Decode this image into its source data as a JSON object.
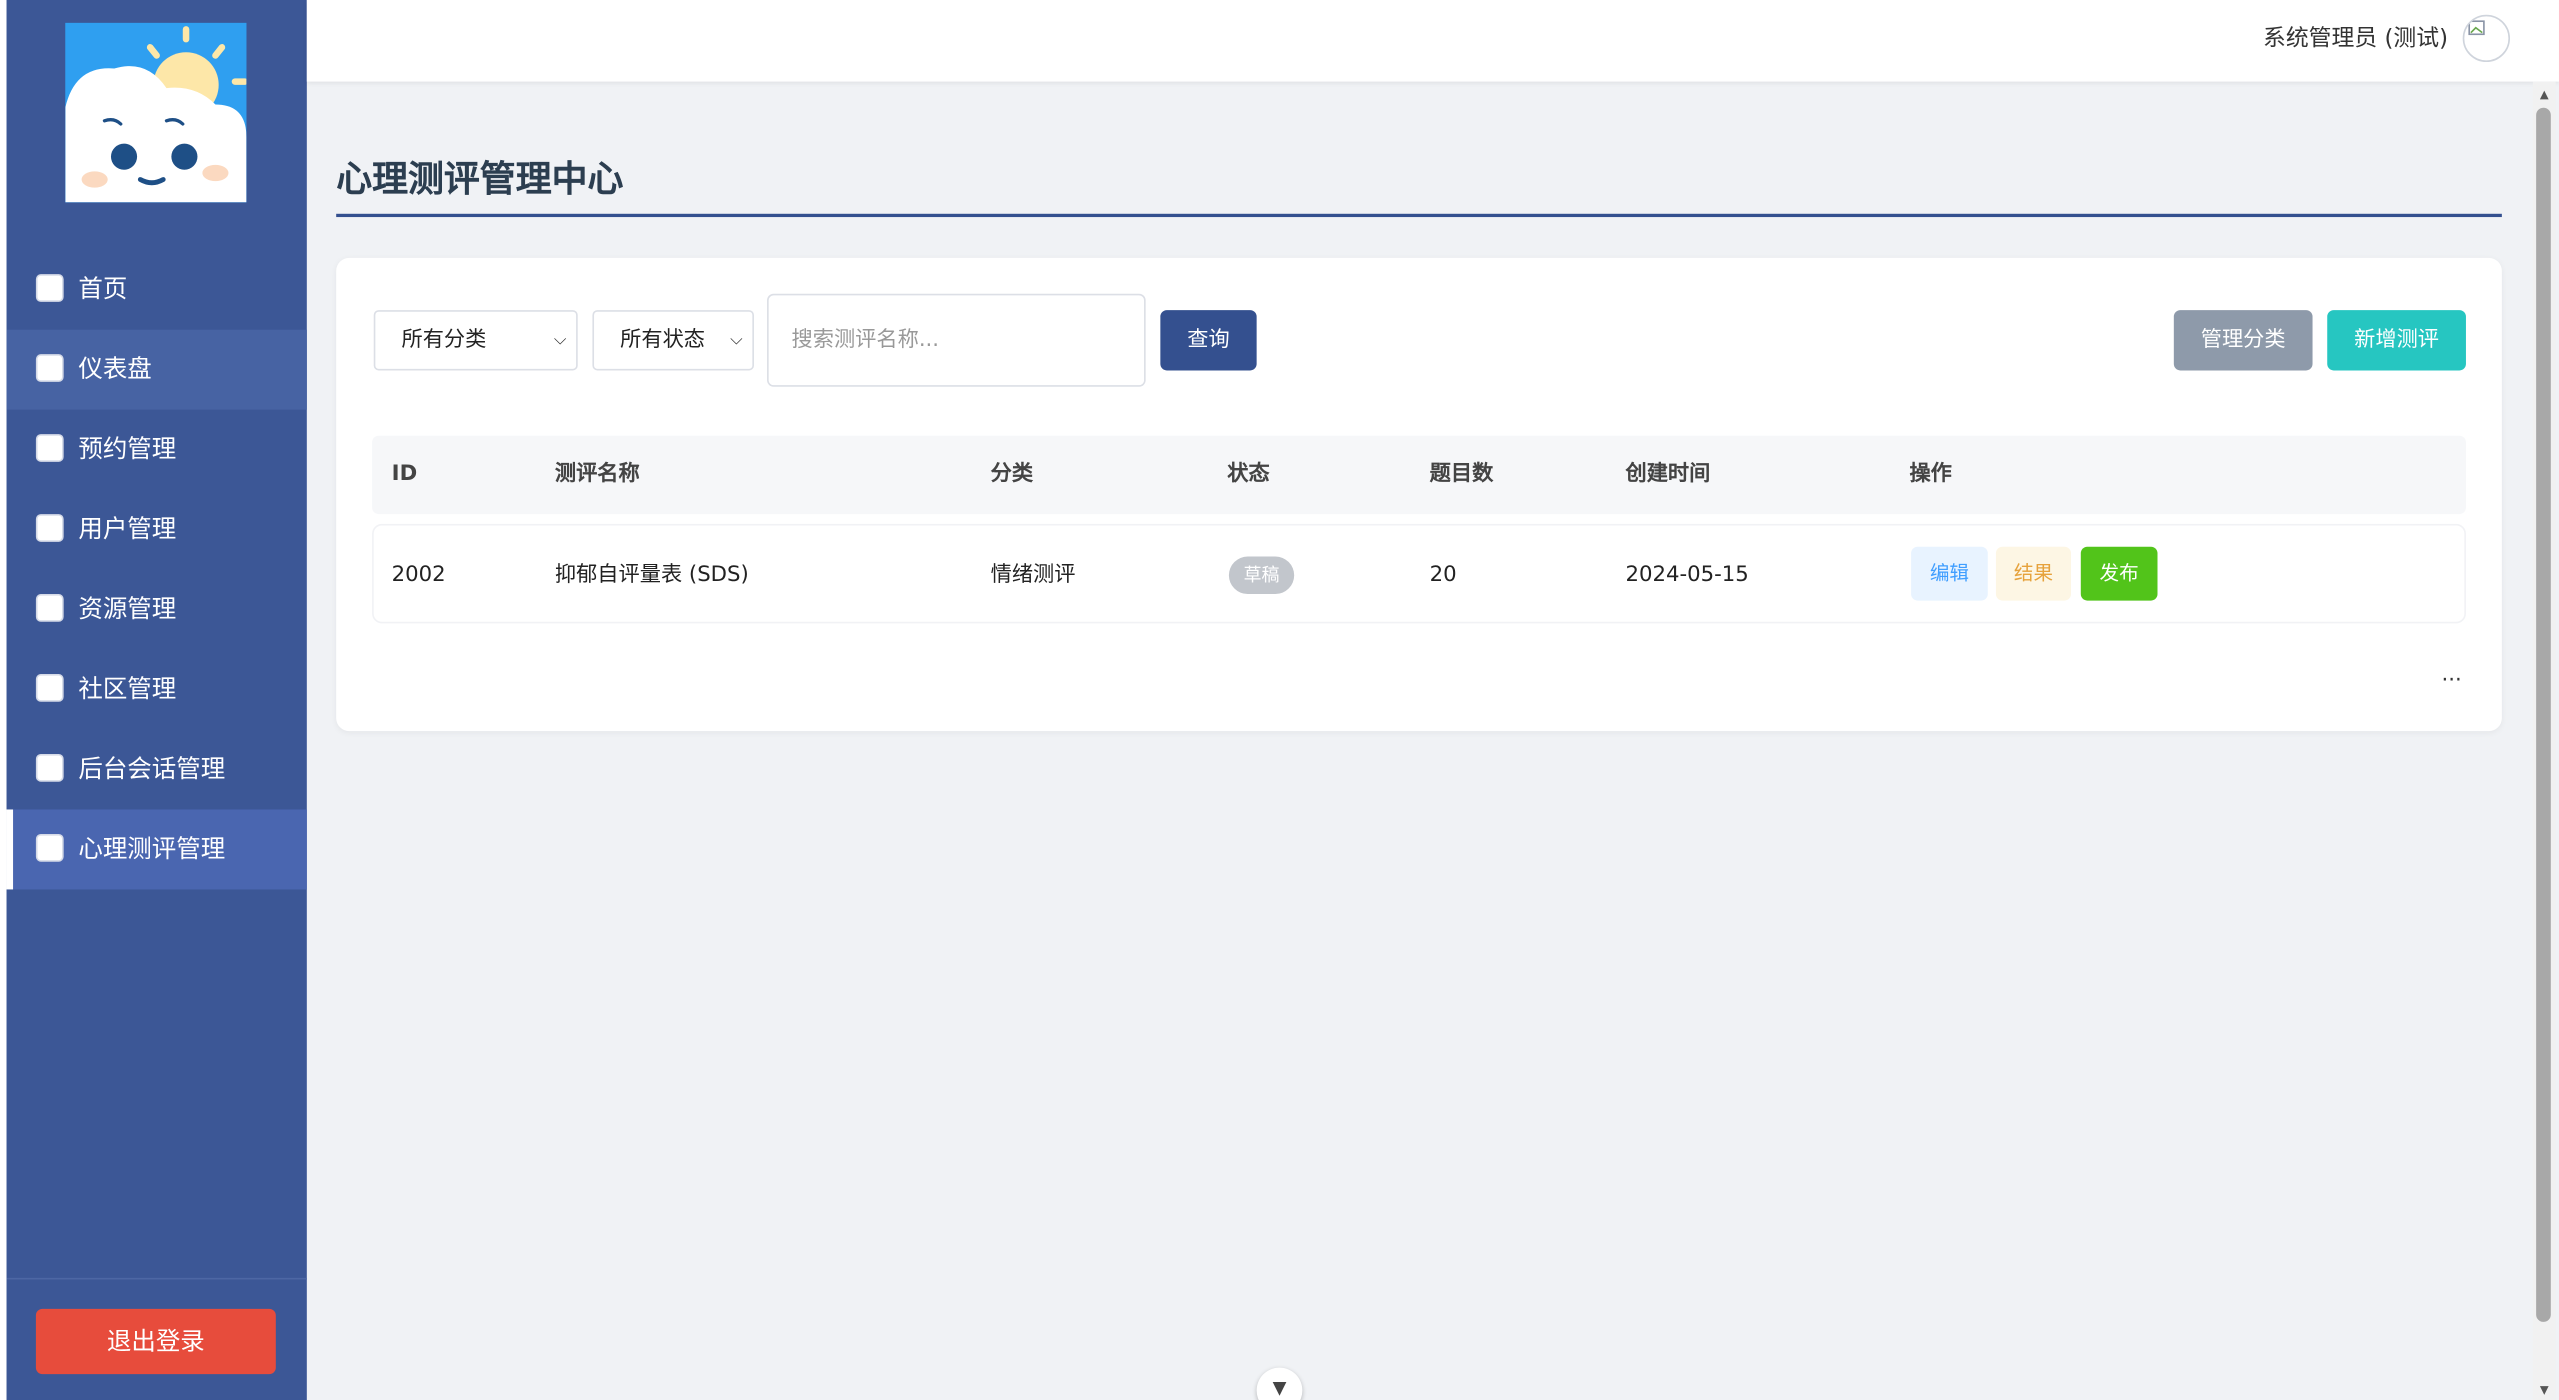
{
  "topbar": {
    "user_name": "系统管理员 (测试)"
  },
  "sidebar": {
    "items": [
      {
        "label": "首页",
        "active": false
      },
      {
        "label": "仪表盘",
        "active": false
      },
      {
        "label": "预约管理",
        "active": false
      },
      {
        "label": "用户管理",
        "active": false
      },
      {
        "label": "资源管理",
        "active": false
      },
      {
        "label": "社区管理",
        "active": false
      },
      {
        "label": "后台会话管理",
        "active": false
      },
      {
        "label": "心理测评管理",
        "active": true
      }
    ],
    "logout_label": "退出登录"
  },
  "page": {
    "title": "心理测评管理中心"
  },
  "filters": {
    "category_select": "所有分类",
    "status_select": "所有状态",
    "search_placeholder": "搜索测评名称...",
    "query_label": "查询",
    "manage_categories_label": "管理分类",
    "add_assessment_label": "新增测评"
  },
  "table": {
    "headers": [
      "ID",
      "测评名称",
      "分类",
      "状态",
      "题目数",
      "创建时间",
      "操作"
    ],
    "rows": [
      {
        "id": "2002",
        "name": "抑郁自评量表 (SDS)",
        "category": "情绪测评",
        "status": "草稿",
        "questions": "20",
        "created": "2024-05-15",
        "actions": [
          "编辑",
          "结果",
          "发布"
        ]
      }
    ]
  },
  "pagination": {
    "more": "..."
  },
  "colors": {
    "sidebar_bg": "#3c5796",
    "accent": "#34508f",
    "logout": "#e74c3c",
    "add_button": "#26c6c1",
    "publish": "#52c41a"
  },
  "icons": {
    "logo": "cloud-sun-mascot-logo",
    "nav": "checkbox-icon",
    "avatar": "avatar-icon",
    "select_chevron": "chevron-down-icon",
    "float": "chevron-down-icon"
  }
}
